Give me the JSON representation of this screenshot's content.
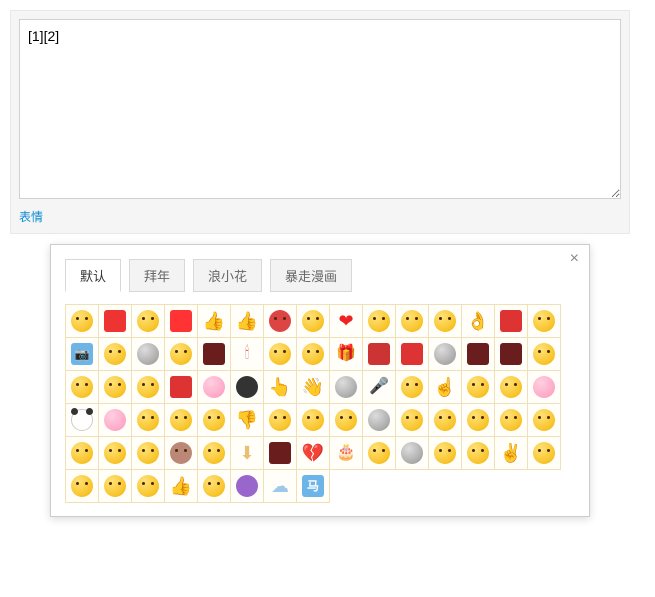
{
  "textarea": {
    "value": "[1][2]"
  },
  "toolbar": {
    "emoji_link": "表情"
  },
  "picker": {
    "close": "×",
    "tabs": [
      {
        "label": "默认",
        "active": true
      },
      {
        "label": "拜年",
        "active": false
      },
      {
        "label": "浪小花",
        "active": false
      },
      {
        "label": "暴走漫画",
        "active": false
      }
    ],
    "emojis": [
      {
        "n": "face-smile",
        "t": "face"
      },
      {
        "n": "red-square",
        "t": "square"
      },
      {
        "n": "face-hearteyes",
        "t": "face"
      },
      {
        "n": "lion",
        "t": "square",
        "c": "#f33"
      },
      {
        "n": "thumb-up",
        "t": "thumb",
        "g": "👍"
      },
      {
        "n": "thumb-up-2",
        "t": "thumb",
        "g": "👍"
      },
      {
        "n": "face-angry",
        "t": "face",
        "c": "#d44"
      },
      {
        "n": "face-smirk",
        "t": "face"
      },
      {
        "n": "heart",
        "t": "heart",
        "g": "❤"
      },
      {
        "n": "face-sick",
        "t": "face"
      },
      {
        "n": "face-cheese",
        "t": "face"
      },
      {
        "n": "face-laugh",
        "t": "face"
      },
      {
        "n": "hand-ok",
        "t": "hand",
        "g": "👌"
      },
      {
        "n": "banner",
        "t": "square",
        "c": "#d33"
      },
      {
        "n": "face-meh",
        "t": "face"
      },
      {
        "n": "camera",
        "t": "blue-sq",
        "g": "📷"
      },
      {
        "n": "face-tongue",
        "t": "face"
      },
      {
        "n": "cat-blue",
        "t": "gray"
      },
      {
        "n": "face-grin",
        "t": "face"
      },
      {
        "n": "trophy",
        "t": "dark"
      },
      {
        "n": "candle",
        "t": "candle",
        "g": "🕯"
      },
      {
        "n": "face-cool",
        "t": "face"
      },
      {
        "n": "face-shades",
        "t": "face"
      },
      {
        "n": "gift",
        "t": "gift",
        "g": "🎁"
      },
      {
        "n": "firecracker",
        "t": "square",
        "c": "#c33"
      },
      {
        "n": "lantern",
        "t": "square",
        "c": "#d33"
      },
      {
        "n": "clock",
        "t": "gray"
      },
      {
        "n": "dark-tile",
        "t": "dark"
      },
      {
        "n": "dark-tile-2",
        "t": "dark"
      },
      {
        "n": "face-drool",
        "t": "face"
      },
      {
        "n": "face-o",
        "t": "face"
      },
      {
        "n": "face-hmm",
        "t": "face"
      },
      {
        "n": "face-money",
        "t": "face"
      },
      {
        "n": "red-envelope",
        "t": "square",
        "c": "#d33"
      },
      {
        "n": "baby",
        "t": "pink"
      },
      {
        "n": "face-dark",
        "t": "gray",
        "c": "#333"
      },
      {
        "n": "hand-point",
        "t": "hand",
        "g": "👆"
      },
      {
        "n": "hand-wave",
        "t": "hand",
        "g": "👋"
      },
      {
        "n": "ultraman",
        "t": "gray"
      },
      {
        "n": "microphone",
        "t": "mic",
        "g": "🎤"
      },
      {
        "n": "face-mad",
        "t": "face"
      },
      {
        "n": "finger",
        "t": "hand",
        "g": "☝"
      },
      {
        "n": "face-worry",
        "t": "face"
      },
      {
        "n": "face-frown",
        "t": "face"
      },
      {
        "n": "face-pink",
        "t": "pink"
      },
      {
        "n": "panda",
        "t": "panda"
      },
      {
        "n": "pig",
        "t": "pink"
      },
      {
        "n": "face-look",
        "t": "face"
      },
      {
        "n": "face-squint",
        "t": "face"
      },
      {
        "n": "face-cry",
        "t": "face"
      },
      {
        "n": "thumb-down",
        "t": "thumb",
        "g": "👎"
      },
      {
        "n": "face-cold",
        "t": "face"
      },
      {
        "n": "face-blank",
        "t": "face"
      },
      {
        "n": "face-flat",
        "t": "face"
      },
      {
        "n": "bear",
        "t": "gray"
      },
      {
        "n": "face-dizzy",
        "t": "face"
      },
      {
        "n": "face-think",
        "t": "face"
      },
      {
        "n": "face-puff",
        "t": "face"
      },
      {
        "n": "face-sad",
        "t": "face"
      },
      {
        "n": "face-happy",
        "t": "face"
      },
      {
        "n": "face-relax",
        "t": "face"
      },
      {
        "n": "face-joy",
        "t": "face"
      },
      {
        "n": "face-sleep",
        "t": "face"
      },
      {
        "n": "hamster",
        "t": "face",
        "c": "#b87"
      },
      {
        "n": "face-sweat",
        "t": "face"
      },
      {
        "n": "download",
        "t": "thumb",
        "g": "⬇"
      },
      {
        "n": "mask",
        "t": "dark"
      },
      {
        "n": "heart-broken",
        "t": "heart",
        "g": "💔"
      },
      {
        "n": "cake",
        "t": "cake",
        "g": "🎂"
      },
      {
        "n": "face-shh",
        "t": "face"
      },
      {
        "n": "ghost",
        "t": "gray"
      },
      {
        "n": "face-whistle",
        "t": "face"
      },
      {
        "n": "face-side",
        "t": "face"
      },
      {
        "n": "hand-v",
        "t": "hand",
        "g": "✌"
      },
      {
        "n": "face-kiss",
        "t": "face"
      },
      {
        "n": "face-wow",
        "t": "face"
      },
      {
        "n": "face-heh",
        "t": "face"
      },
      {
        "n": "face-tilt",
        "t": "face"
      },
      {
        "n": "thumb-like",
        "t": "thumb",
        "g": "👍"
      },
      {
        "n": "face-shock",
        "t": "face"
      },
      {
        "n": "face-purple",
        "t": "gray",
        "c": "#96c"
      },
      {
        "n": "cloud",
        "t": "cloud",
        "g": "☁"
      },
      {
        "n": "horse",
        "t": "blue-sq",
        "g": "马"
      }
    ]
  }
}
